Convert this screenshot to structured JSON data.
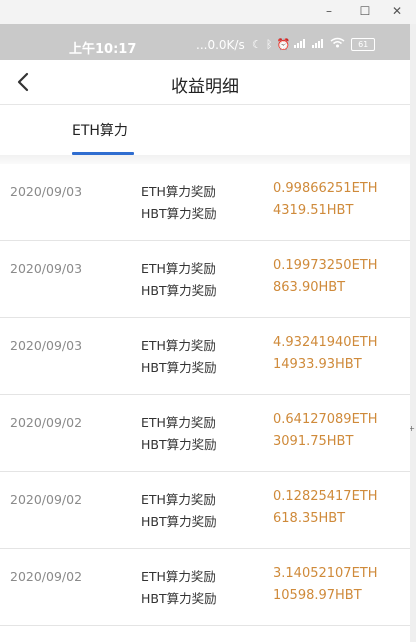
{
  "window": {
    "minimize": "–",
    "maximize": "☐",
    "close": "✕"
  },
  "status_bar": {
    "time": "上午10:17",
    "network_speed": "...0.0K/s",
    "battery": "61"
  },
  "header": {
    "title": "收益明细"
  },
  "tabs": [
    {
      "label": "ETH算力",
      "active": true
    }
  ],
  "colors": {
    "accent": "#2f6dd0",
    "value": "#cf8a3a"
  },
  "records": [
    {
      "date": "2020/09/03",
      "eth_label": "ETH算力奖励",
      "eth_value": "0.99866251ETH",
      "hbt_label": "HBT算力奖励",
      "hbt_value": "4319.51HBT"
    },
    {
      "date": "2020/09/03",
      "eth_label": "ETH算力奖励",
      "eth_value": "0.19973250ETH",
      "hbt_label": "HBT算力奖励",
      "hbt_value": "863.90HBT"
    },
    {
      "date": "2020/09/03",
      "eth_label": "ETH算力奖励",
      "eth_value": "4.93241940ETH",
      "hbt_label": "HBT算力奖励",
      "hbt_value": "14933.93HBT"
    },
    {
      "date": "2020/09/02",
      "eth_label": "ETH算力奖励",
      "eth_value": "0.64127089ETH",
      "hbt_label": "HBT算力奖励",
      "hbt_value": "3091.75HBT"
    },
    {
      "date": "2020/09/02",
      "eth_label": "ETH算力奖励",
      "eth_value": "0.12825417ETH",
      "hbt_label": "HBT算力奖励",
      "hbt_value": "618.35HBT"
    },
    {
      "date": "2020/09/02",
      "eth_label": "ETH算力奖励",
      "eth_value": "3.14052107ETH",
      "hbt_label": "HBT算力奖励",
      "hbt_value": "10598.97HBT"
    }
  ]
}
